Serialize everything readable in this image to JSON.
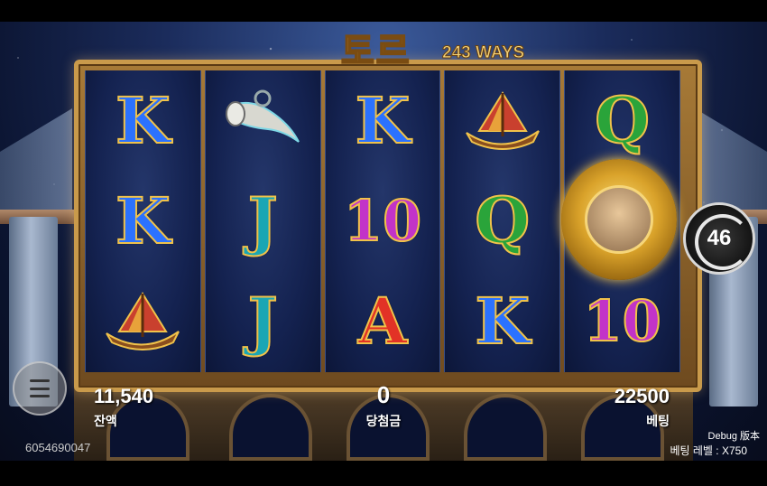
{
  "game": {
    "title": "토르",
    "ways_label": "243 WAYS"
  },
  "reels": [
    [
      {
        "sym": "K",
        "cls": "k"
      },
      {
        "sym": "K",
        "cls": "k"
      },
      {
        "sym": "ship",
        "cls": "ship"
      }
    ],
    [
      {
        "sym": "horn",
        "cls": "horn"
      },
      {
        "sym": "J",
        "cls": "j"
      },
      {
        "sym": "J",
        "cls": "j"
      }
    ],
    [
      {
        "sym": "K",
        "cls": "k"
      },
      {
        "sym": "10",
        "cls": "ten"
      },
      {
        "sym": "A",
        "cls": "a"
      }
    ],
    [
      {
        "sym": "ship",
        "cls": "ship"
      },
      {
        "sym": "Q",
        "cls": "q"
      },
      {
        "sym": "K",
        "cls": "k"
      }
    ],
    [
      {
        "sym": "Q",
        "cls": "q"
      },
      {
        "sym": "wild",
        "cls": "wild"
      },
      {
        "sym": "10",
        "cls": "ten"
      }
    ]
  ],
  "spin": {
    "autospin_count": "46"
  },
  "balance": {
    "value": "11,540",
    "label": "잔액"
  },
  "win": {
    "value": "0",
    "label": "당첨금"
  },
  "bet": {
    "value": "22500",
    "label": "베팅"
  },
  "session_id": "6054690047",
  "debug_label": "Debug 版本",
  "bet_level_label": "베팅 레벨 : X750",
  "colors": {
    "frame_gold": "#c99a4b",
    "title_gold": "#f4d37a"
  }
}
